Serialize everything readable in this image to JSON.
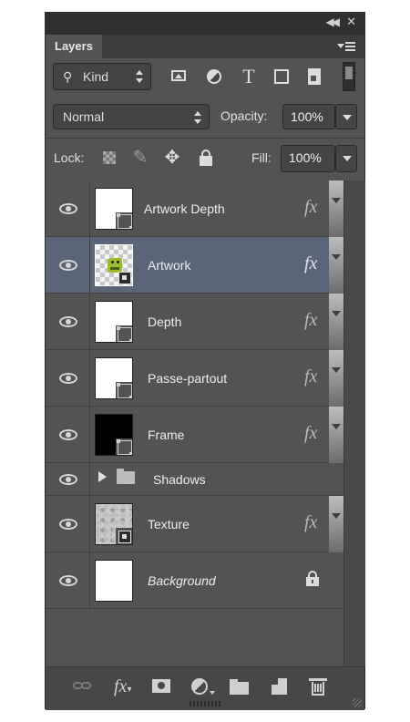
{
  "panel": {
    "title": "Layers",
    "collapse_icon": "double-chevron-left-icon",
    "close_icon": "close-icon",
    "menu_icon": "panel-menu-icon"
  },
  "filter": {
    "kind_label": "Kind",
    "filter_icons": [
      "image-filter-icon",
      "adjustment-filter-icon",
      "type-filter-icon",
      "shape-filter-icon",
      "smart-object-filter-icon"
    ]
  },
  "blend": {
    "mode": "Normal",
    "opacity_label": "Opacity:",
    "opacity_value": "100%"
  },
  "lock": {
    "label": "Lock:",
    "fill_label": "Fill:",
    "fill_value": "100%"
  },
  "layers": [
    {
      "name": "Artwork Depth",
      "thumb": "white",
      "badge": "smart",
      "fx": true,
      "selected": false
    },
    {
      "name": "Artwork",
      "thumb": "checker-frog",
      "badge": "linked",
      "fx": true,
      "selected": true
    },
    {
      "name": "Depth",
      "thumb": "white",
      "badge": "smart",
      "fx": true,
      "selected": false
    },
    {
      "name": "Passe-partout",
      "thumb": "white",
      "badge": "smart",
      "fx": true,
      "selected": false
    },
    {
      "name": "Frame",
      "thumb": "black",
      "badge": "smart",
      "fx": true,
      "selected": false
    },
    {
      "name": "Shadows",
      "type": "group",
      "collapsed": true
    },
    {
      "name": "Texture",
      "thumb": "stone",
      "badge": "linked",
      "fx": true,
      "selected": false
    },
    {
      "name": "Background",
      "thumb": "white",
      "locked": true,
      "fx": false,
      "selected": false
    }
  ],
  "fx_label": "fx",
  "bottom_bar": {
    "icons": [
      "link-layers-icon",
      "add-style-icon",
      "add-mask-icon",
      "new-adjustment-icon",
      "new-group-icon",
      "new-layer-icon",
      "delete-layer-icon"
    ],
    "fx_label": "fx"
  },
  "colors": {
    "panel_bg": "#535353",
    "selected_row": "#5a6577",
    "text": "#ececec"
  }
}
